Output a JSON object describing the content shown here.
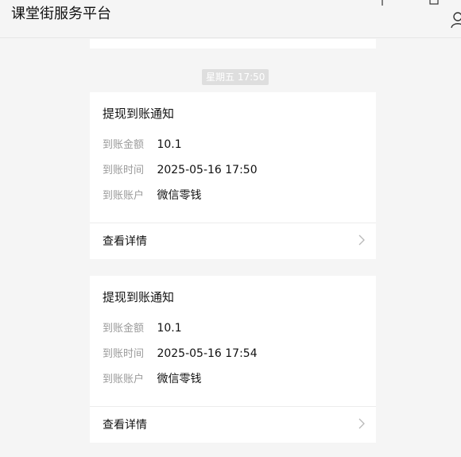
{
  "app": {
    "title": "课堂街服务平台"
  },
  "messages": {
    "timestamp": "星期五 17:50",
    "cards": [
      {
        "title": "提现到账通知",
        "fields": [
          {
            "label": "到账金额",
            "value": "10.1"
          },
          {
            "label": "到账时间",
            "value": "2025-05-16 17:50"
          },
          {
            "label": "到账账户",
            "value": "微信零钱"
          }
        ],
        "details_label": "查看详情"
      },
      {
        "title": "提现到账通知",
        "fields": [
          {
            "label": "到账金额",
            "value": "10.1"
          },
          {
            "label": "到账时间",
            "value": "2025-05-16 17:54"
          },
          {
            "label": "到账账户",
            "value": "微信零钱"
          }
        ],
        "details_label": "查看详情"
      }
    ]
  },
  "icons": {
    "pin": "pin-icon",
    "maximize": "maximize-icon",
    "user": "user-icon",
    "chevron": "chevron-right-icon"
  },
  "colors": {
    "background": "#f5f5f5",
    "card": "#ffffff",
    "label_text": "#9a9a9a",
    "pill_bg": "#dedede"
  }
}
